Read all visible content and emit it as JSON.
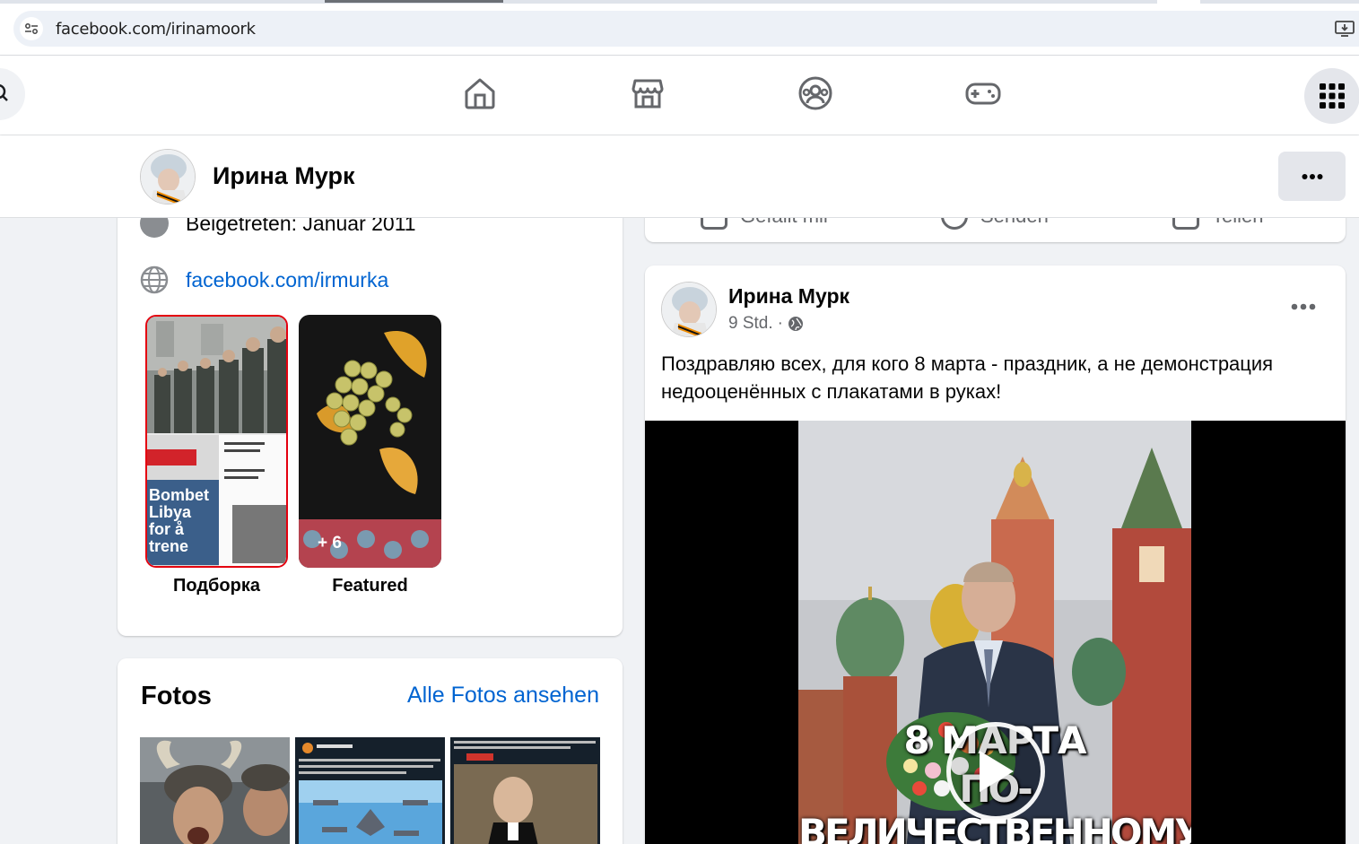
{
  "browser": {
    "url": "facebook.com/irinamoork"
  },
  "profile": {
    "name": "Ирина Мурк"
  },
  "intro": {
    "joined": "Beigetreten: Januar 2011",
    "link": "facebook.com/irmurka",
    "highlights": [
      {
        "label": "Подборка"
      },
      {
        "label": "Featured",
        "count": "+ 6"
      }
    ]
  },
  "photos": {
    "title": "Fotos",
    "see_all": "Alle Fotos ansehen"
  },
  "previous_post": {
    "actions": [
      "Gefällt mir",
      "Senden",
      "Teilen"
    ]
  },
  "post": {
    "author": "Ирина Мурк",
    "time": "9 Std.",
    "separator": "·",
    "text": "Поздравляю всех, для кого 8 марта - праздник, а не демонстрация недооценённых с плакатами в руках!",
    "video_caption_line1": "8 МАРТА",
    "video_caption_line2": "ПО-ВЕЛИЧЕСТВЕННОМУ"
  },
  "colors": {
    "link": "#0064d1",
    "background": "#f0f2f5",
    "secondary_text": "#65676b"
  }
}
